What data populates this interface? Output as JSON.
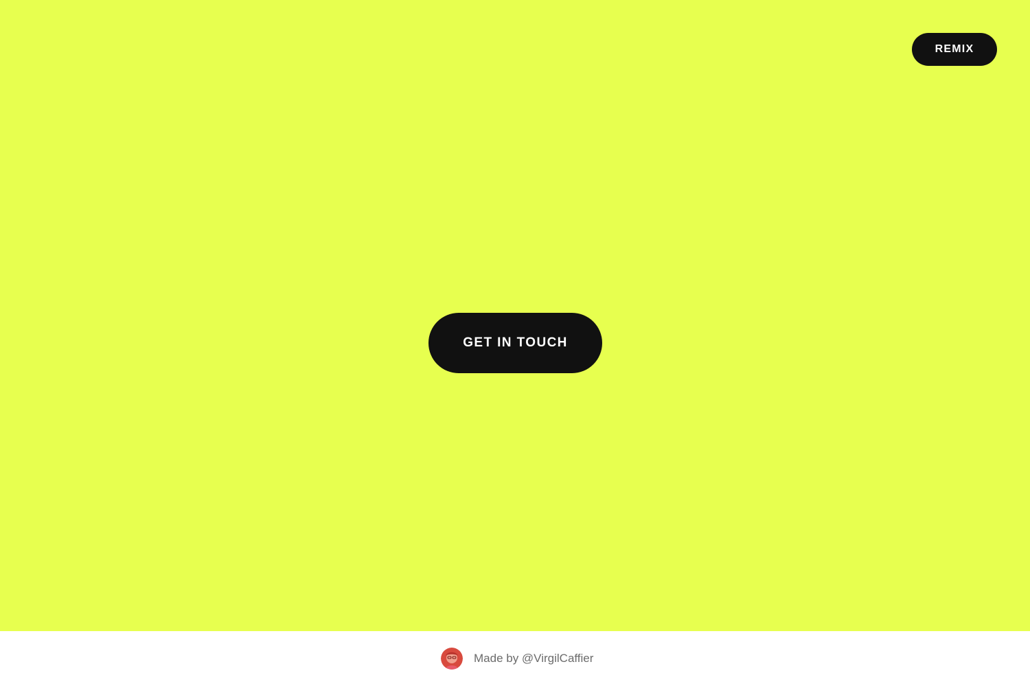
{
  "page": {
    "background_color": "#e7ff4f",
    "footer_background_color": "#ffffff"
  },
  "header": {
    "remix_label": "REMIX"
  },
  "main": {
    "cta_label": "GET IN TOUCH",
    "button_color": "#111111",
    "button_text_color": "#ffffff"
  },
  "footer": {
    "avatar_icon": "avatar-icon",
    "credit_text": "Made by @VirgilCaffier",
    "credit_text_color": "#6b6b6b"
  }
}
